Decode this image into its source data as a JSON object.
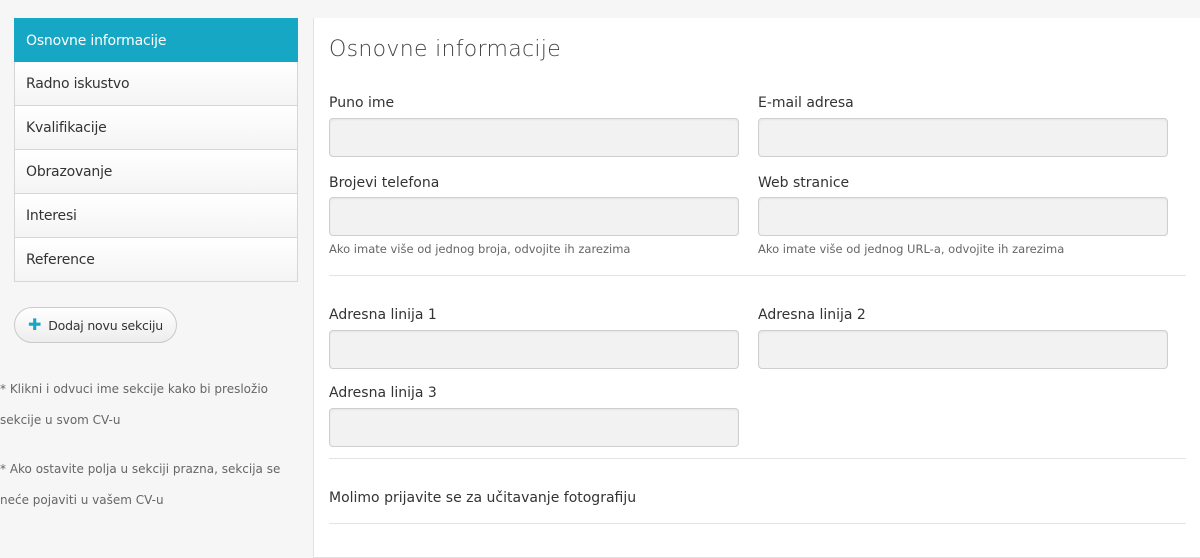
{
  "sidebar": {
    "items": [
      {
        "label": "Osnovne informacije",
        "active": true
      },
      {
        "label": "Radno iskustvo"
      },
      {
        "label": "Kvalifikacije"
      },
      {
        "label": "Obrazovanje"
      },
      {
        "label": "Interesi"
      },
      {
        "label": "Reference"
      }
    ],
    "add_button": "Dodaj novu sekciju",
    "note_drag": "* Klikni i odvuci ime sekcije kako bi presložio sekcije u svom CV-u",
    "note_empty": "* Ako ostavite polja u sekciji prazna, sekcija se neće pojaviti u vašem CV-u"
  },
  "main": {
    "title": "Osnovne informacije",
    "fields": {
      "full_name": {
        "label": "Puno ime",
        "value": ""
      },
      "email": {
        "label": "E-mail adresa",
        "value": ""
      },
      "phones": {
        "label": "Brojevi telefona",
        "value": "",
        "hint": "Ako imate više od jednog broja, odvojite ih zarezima"
      },
      "websites": {
        "label": "Web stranice",
        "value": "",
        "hint": "Ako imate više od jednog URL-a, odvojite ih zarezima"
      },
      "address1": {
        "label": "Adresna linija 1",
        "value": ""
      },
      "address2": {
        "label": "Adresna linija 2",
        "value": ""
      },
      "address3": {
        "label": "Adresna linija 3",
        "value": ""
      }
    },
    "photo_note": "Molimo prijavite se za učitavanje fotografiju"
  },
  "colors": {
    "accent": "#15a7c4"
  }
}
